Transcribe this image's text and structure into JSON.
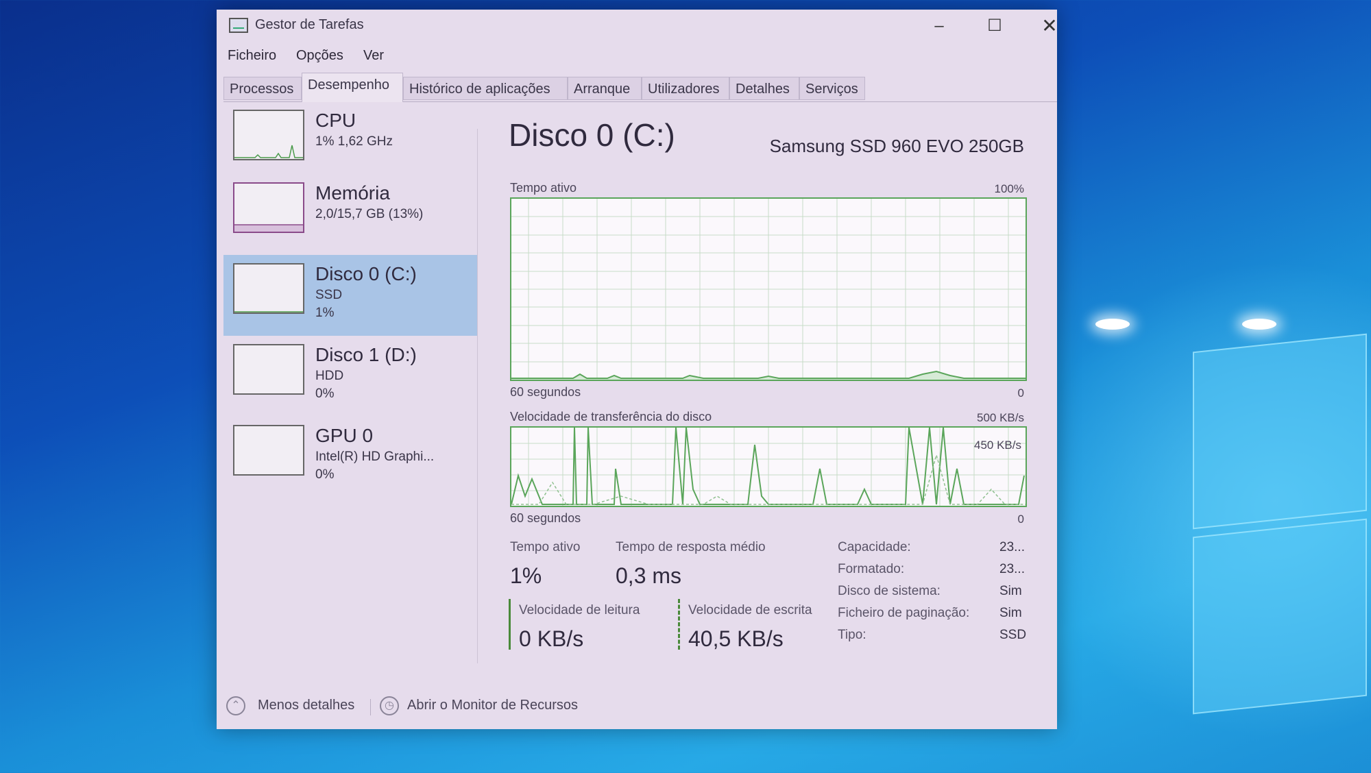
{
  "window": {
    "title": "Gestor de Tarefas",
    "controls": {
      "minimize": "–",
      "maximize": "☐",
      "close": "✕"
    }
  },
  "menu": [
    "Ficheiro",
    "Opções",
    "Ver"
  ],
  "tabs": [
    {
      "label": "Processos",
      "active": false
    },
    {
      "label": "Desempenho",
      "active": true
    },
    {
      "label": "Histórico de aplicações",
      "active": false
    },
    {
      "label": "Arranque",
      "active": false
    },
    {
      "label": "Utilizadores",
      "active": false
    },
    {
      "label": "Detalhes",
      "active": false
    },
    {
      "label": "Serviços",
      "active": false
    }
  ],
  "sidebar": [
    {
      "title": "CPU",
      "line1": "1% 1,62 GHz",
      "line2": ""
    },
    {
      "title": "Memória",
      "line1": "2,0/15,7 GB (13%)",
      "line2": ""
    },
    {
      "title": "Disco 0 (C:)",
      "line1": "SSD",
      "line2": "1%",
      "selected": true
    },
    {
      "title": "Disco 1 (D:)",
      "line1": "HDD",
      "line2": "0%"
    },
    {
      "title": "GPU 0",
      "line1": "Intel(R) HD Graphi...",
      "line2": "0%"
    }
  ],
  "main": {
    "title": "Disco 0 (C:)",
    "model": "Samsung SSD 960 EVO 250GB",
    "graph1": {
      "label": "Tempo ativo",
      "max": "100%",
      "time": "60 segundos",
      "min": "0"
    },
    "graph2": {
      "label": "Velocidade de transferência do disco",
      "max": "500 KB/s",
      "inner": "450 KB/s",
      "time": "60 segundos",
      "min": "0"
    },
    "stats": {
      "active_label": "Tempo ativo",
      "active_value": "1%",
      "response_label": "Tempo de resposta médio",
      "response_value": "0,3 ms",
      "read_label": "Velocidade de leitura",
      "read_value": "0 KB/s",
      "write_label": "Velocidade de escrita",
      "write_value": "40,5 KB/s"
    },
    "properties": [
      {
        "label": "Capacidade:",
        "value": "23..."
      },
      {
        "label": "Formatado:",
        "value": "23..."
      },
      {
        "label": "Disco de sistema:",
        "value": "Sim"
      },
      {
        "label": "Ficheiro de paginação:",
        "value": "Sim"
      },
      {
        "label": "Tipo:",
        "value": "SSD"
      }
    ]
  },
  "footer": {
    "less_details": "Menos detalhes",
    "resource_monitor": "Abrir o Monitor de Recursos"
  },
  "colors": {
    "graph_line": "#5aa55a",
    "selected": "#a9c4e6",
    "window_bg": "#e6dcec"
  }
}
